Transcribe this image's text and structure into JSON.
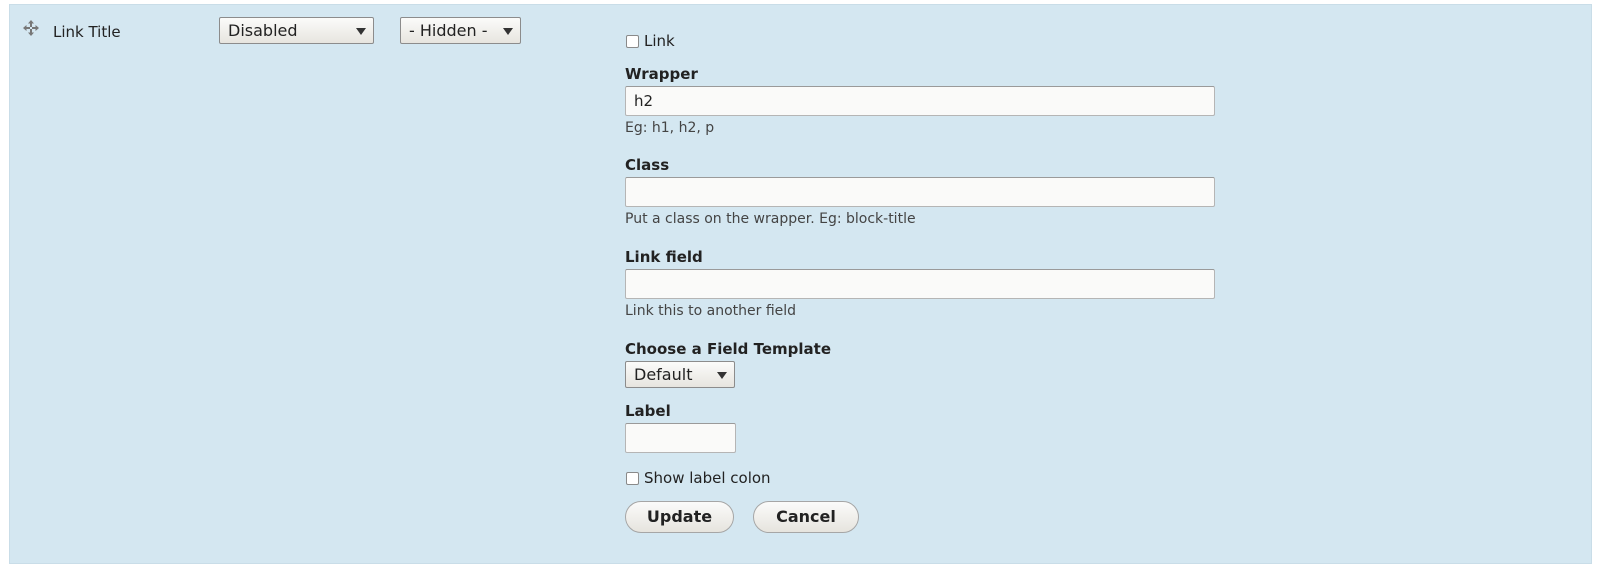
{
  "row": {
    "title": "Link Title",
    "drag_icon": "move-cross-arrows-icon"
  },
  "format_select": {
    "value": "Disabled"
  },
  "label_select": {
    "value": "- Hidden -"
  },
  "settings": {
    "link_checkbox_label": "Link",
    "link_checked": false,
    "wrapper": {
      "label": "Wrapper",
      "value": "h2",
      "description": "Eg: h1, h2, p"
    },
    "class": {
      "label": "Class",
      "value": "",
      "description": "Put a class on the wrapper. Eg: block-title"
    },
    "link_field": {
      "label": "Link field",
      "value": "",
      "description": "Link this to another field"
    },
    "field_template": {
      "label": "Choose a Field Template",
      "value": "Default"
    },
    "label_field": {
      "label": "Label",
      "value": ""
    },
    "show_label_colon": {
      "label": "Show label colon",
      "checked": false
    },
    "buttons": {
      "update": "Update",
      "cancel": "Cancel"
    }
  },
  "colors": {
    "panel_background": "#d4e7f1"
  }
}
